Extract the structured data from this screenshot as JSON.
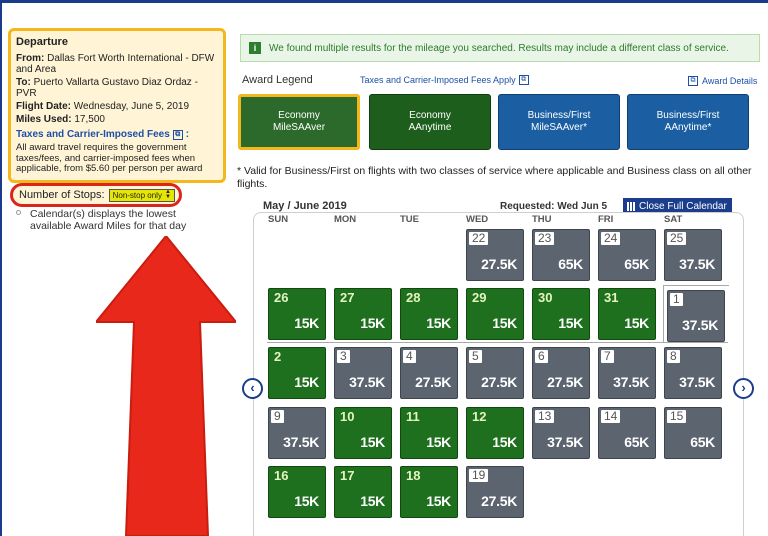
{
  "trip": {
    "title": "Departure",
    "from_label": "From:",
    "from_value": "Dallas Fort Worth International - DFW and Area",
    "to_label": "To:",
    "to_value": "Puerto Vallarta Gustavo Diaz Ordaz - PVR",
    "date_label": "Flight Date:",
    "date_value": "Wednesday, June 5, 2019",
    "miles_label": "Miles Used:",
    "miles_value": "17,500",
    "fees_link": "Taxes and Carrier-Imposed Fees",
    "fees_colon": ":",
    "fees_text": "All award travel requires the government taxes/fees, and carrier-imposed fees when applicable, from $5.60 per person per award"
  },
  "stops": {
    "label": "Number of Stops:",
    "selected": "Non-stop only"
  },
  "calendar_note": "Calendar(s) displays the lowest available Award Miles for that day",
  "banner": {
    "text": "We found multiple results for the mileage you searched. Results may include a different class of service."
  },
  "legend": {
    "title": "Award Legend",
    "taxes_link": "Taxes and Carrier-Imposed Fees Apply",
    "details_link": "Award Details",
    "options": [
      {
        "line1": "Economy",
        "line2": "MileSAAver",
        "style": "green",
        "selected": true
      },
      {
        "line1": "Economy",
        "line2": "AAnytime",
        "style": "green",
        "selected": false
      },
      {
        "line1": "Business/First",
        "line2": "MileSAAver*",
        "style": "blue",
        "selected": false
      },
      {
        "line1": "Business/First",
        "line2": "AAnytime*",
        "style": "blue",
        "selected": false
      }
    ]
  },
  "valid_note": "* Valid for Business/First on flights with two classes of service where applicable and Business class on all other flights.",
  "calendar": {
    "month_label": "May / June 2019",
    "requested": "Requested: Wed Jun 5",
    "close_button": "Close Full Calendar",
    "weekdays": [
      "SUN",
      "MON",
      "TUE",
      "WED",
      "THU",
      "FRI",
      "SAT"
    ],
    "days": [
      {
        "day": "22",
        "miles": "27.5K",
        "status": "gray",
        "col": 3,
        "row": 0
      },
      {
        "day": "23",
        "miles": "65K",
        "status": "gray",
        "col": 4,
        "row": 0
      },
      {
        "day": "24",
        "miles": "65K",
        "status": "gray",
        "col": 5,
        "row": 0
      },
      {
        "day": "25",
        "miles": "37.5K",
        "status": "gray",
        "col": 6,
        "row": 0
      },
      {
        "day": "26",
        "miles": "15K",
        "status": "green",
        "col": 0,
        "row": 1
      },
      {
        "day": "27",
        "miles": "15K",
        "status": "green",
        "col": 1,
        "row": 1
      },
      {
        "day": "28",
        "miles": "15K",
        "status": "green",
        "col": 2,
        "row": 1
      },
      {
        "day": "29",
        "miles": "15K",
        "status": "green",
        "col": 3,
        "row": 1
      },
      {
        "day": "30",
        "miles": "15K",
        "status": "green",
        "col": 4,
        "row": 1
      },
      {
        "day": "31",
        "miles": "15K",
        "status": "green",
        "col": 5,
        "row": 1
      },
      {
        "day": "1",
        "miles": "37.5K",
        "status": "gray",
        "col": 6,
        "row": 1
      },
      {
        "day": "2",
        "miles": "15K",
        "status": "green",
        "col": 0,
        "row": 2
      },
      {
        "day": "3",
        "miles": "37.5K",
        "status": "gray",
        "col": 1,
        "row": 2
      },
      {
        "day": "4",
        "miles": "27.5K",
        "status": "gray",
        "col": 2,
        "row": 2
      },
      {
        "day": "5",
        "miles": "27.5K",
        "status": "gray",
        "col": 3,
        "row": 2
      },
      {
        "day": "6",
        "miles": "27.5K",
        "status": "gray",
        "col": 4,
        "row": 2
      },
      {
        "day": "7",
        "miles": "37.5K",
        "status": "gray",
        "col": 5,
        "row": 2
      },
      {
        "day": "8",
        "miles": "37.5K",
        "status": "gray",
        "col": 6,
        "row": 2
      },
      {
        "day": "9",
        "miles": "37.5K",
        "status": "gray",
        "col": 0,
        "row": 3
      },
      {
        "day": "10",
        "miles": "15K",
        "status": "green",
        "col": 1,
        "row": 3
      },
      {
        "day": "11",
        "miles": "15K",
        "status": "green",
        "col": 2,
        "row": 3
      },
      {
        "day": "12",
        "miles": "15K",
        "status": "green",
        "col": 3,
        "row": 3
      },
      {
        "day": "13",
        "miles": "37.5K",
        "status": "gray",
        "col": 4,
        "row": 3
      },
      {
        "day": "14",
        "miles": "65K",
        "status": "gray",
        "col": 5,
        "row": 3
      },
      {
        "day": "15",
        "miles": "65K",
        "status": "gray",
        "col": 6,
        "row": 3
      },
      {
        "day": "16",
        "miles": "15K",
        "status": "green",
        "col": 0,
        "row": 4
      },
      {
        "day": "17",
        "miles": "15K",
        "status": "green",
        "col": 1,
        "row": 4
      },
      {
        "day": "18",
        "miles": "15K",
        "status": "green",
        "col": 2,
        "row": 4
      },
      {
        "day": "19",
        "miles": "27.5K",
        "status": "gray",
        "col": 3,
        "row": 4
      }
    ]
  },
  "colors": {
    "brand_blue": "#1b3d8c",
    "award_green": "#1e6f1e",
    "unavailable_gray": "#5c6470",
    "highlight_yellow": "#f2b81c",
    "annotation_red": "#e8281a"
  },
  "icons": {
    "prev": "chevron-left-icon",
    "next": "chevron-right-icon",
    "info": "info-icon",
    "external": "external-link-icon",
    "calendar": "calendar-grid-icon"
  }
}
